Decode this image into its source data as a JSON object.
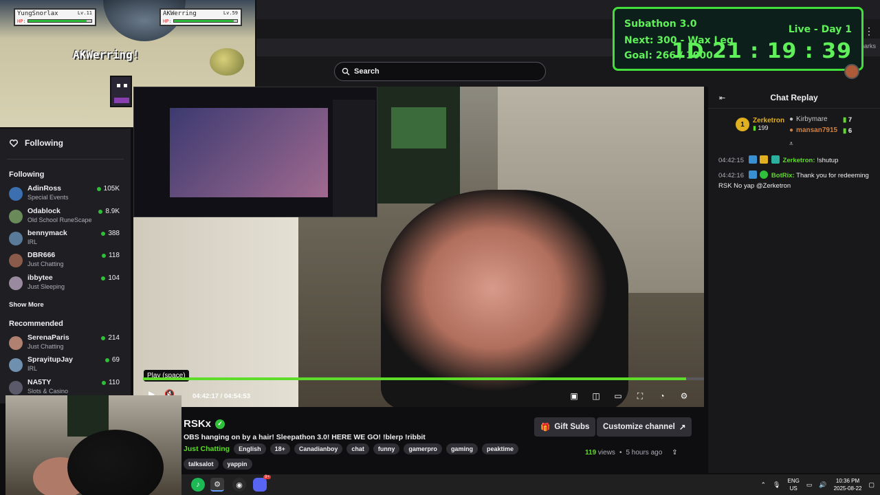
{
  "game": {
    "player1_name": "YungSnorlax",
    "player1_level": "Lv.11",
    "player1_hp_label": "HP:",
    "player1_hp_fraction": 0.92,
    "player2_name": "AKWerring",
    "player2_level": "Lv.59",
    "player2_hp_label": "HP:",
    "player2_hp_fraction": 0.95,
    "message": "AKWerring!",
    "number": "2"
  },
  "nav": {
    "search_placeholder": "Search",
    "bookmarks_label": "rmarks"
  },
  "sidebar": {
    "following_title": "Following",
    "following_header": "Following",
    "following": [
      {
        "name": "AdinRoss",
        "category": "Special Events",
        "viewers": "105K",
        "color": "#3b6fb0"
      },
      {
        "name": "Odablock",
        "category": "Old School RuneScape",
        "viewers": "8.9K",
        "color": "#6a8a5a"
      },
      {
        "name": "bennymack",
        "category": "IRL",
        "viewers": "388",
        "color": "#5a7a9a"
      },
      {
        "name": "DBR666",
        "category": "Just Chatting",
        "viewers": "118",
        "color": "#8a5a4a"
      },
      {
        "name": "ibbytee",
        "category": "Just Sleeping",
        "viewers": "104",
        "color": "#9a8aa0"
      }
    ],
    "show_more": "Show More",
    "recommended_header": "Recommended",
    "recommended": [
      {
        "name": "SerenaParis",
        "category": "Just Chatting",
        "viewers": "214",
        "color": "#b08070"
      },
      {
        "name": "SprayitupJay",
        "category": "IRL",
        "viewers": "69",
        "color": "#7090b0"
      },
      {
        "name": "NA5TY",
        "category": "Slots & Casino",
        "viewers": "110",
        "color": "#5a5a6a"
      }
    ]
  },
  "player": {
    "tooltip": "Play (space)",
    "time_current": "04:42:17",
    "time_separator": "/",
    "time_total": "04:54:53",
    "progress_fraction": 0.968
  },
  "stream": {
    "channel": "RSKx",
    "title": "OBS hanging on by a hair! Sleepathon 3.0! HERE WE GO! !blerp !ribbit",
    "category": "Just Chatting",
    "tags": [
      "English",
      "18+",
      "Canadianboy",
      "chat",
      "funny",
      "gamerpro",
      "gaming",
      "peaktime"
    ],
    "tags_row2": [
      "talksalot",
      "yappin"
    ],
    "gift_subs_label": "Gift Subs",
    "customize_label": "Customize channel",
    "views_count": "119",
    "views_label": "views",
    "age": "5 hours ago"
  },
  "chat": {
    "title": "Chat Replay",
    "leaderboard": {
      "first": {
        "rank": "1",
        "name": "Zerketron",
        "count": "199"
      },
      "second": {
        "name": "Kirbymare",
        "count": "7"
      },
      "third": {
        "name": "mansan7915",
        "count": "6"
      }
    },
    "messages": [
      {
        "time": "04:42:15",
        "user": "Zerketron",
        "text": "!shutup",
        "color": "#5edc2a"
      },
      {
        "time": "04:42:16",
        "user": "BotRix",
        "text": "Thank you for redeeming RSK No yap @Zerketron",
        "color": "#5edc2a"
      }
    ]
  },
  "overlay": {
    "title": "Subathon 3.0",
    "next": "Next: 300 - Wax Leg",
    "goal": "Goal: 266 / 1000",
    "live": "Live - Day 1",
    "timer": "1D  21 : 19 : 39"
  },
  "taskbar": {
    "lang_line1": "ENG",
    "lang_line2": "US",
    "time": "10:36 PM",
    "date": "2025-08-22",
    "discord_badge": "9+"
  }
}
